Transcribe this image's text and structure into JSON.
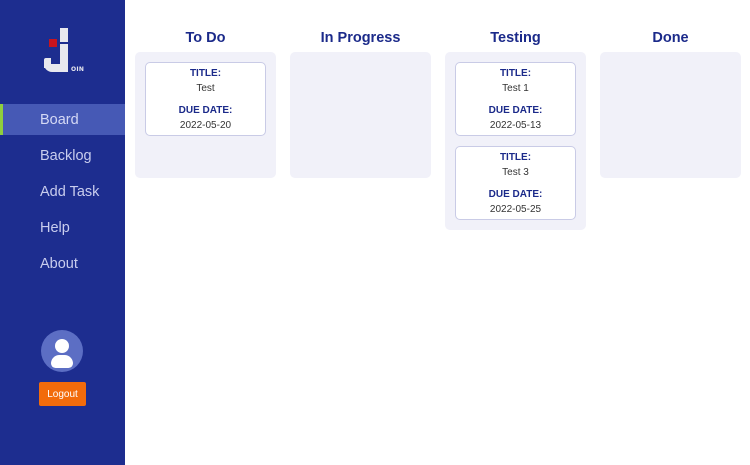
{
  "sidebar": {
    "logo_text": "OIN",
    "nav": [
      "Board",
      "Backlog",
      "Add Task",
      "Help",
      "About"
    ],
    "active_index": 0,
    "logout_label": "Logout"
  },
  "board": {
    "columns": [
      {
        "title": "To Do",
        "cards": [
          {
            "title_label": "TITLE:",
            "title": "Test",
            "due_label": "DUE DATE:",
            "due": "2022-05-20"
          }
        ]
      },
      {
        "title": "In Progress",
        "cards": []
      },
      {
        "title": "Testing",
        "cards": [
          {
            "title_label": "TITLE:",
            "title": "Test 1",
            "due_label": "DUE DATE:",
            "due": "2022-05-13"
          },
          {
            "title_label": "TITLE:",
            "title": "Test 3",
            "due_label": "DUE DATE:",
            "due": "2022-05-25"
          }
        ]
      },
      {
        "title": "Done",
        "cards": []
      }
    ]
  },
  "colors": {
    "sidebar_bg": "#1d2d8f",
    "accent_active": "#8fcf3e",
    "logout_bg": "#f26b0b",
    "heading": "#1b2a8a",
    "column_bg": "#f1f1f9"
  }
}
